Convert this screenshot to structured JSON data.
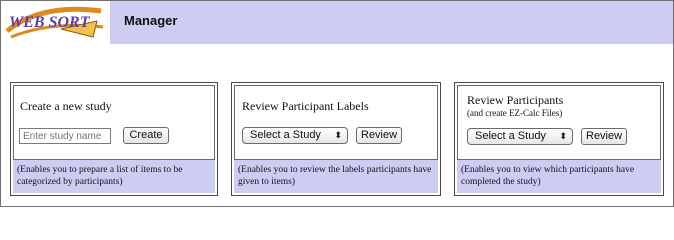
{
  "header": {
    "logo_text": "WEB SORT",
    "title": "Manager"
  },
  "panels": [
    {
      "title": "Create a new study",
      "input_placeholder": "Enter study name",
      "button_label": "Create",
      "description": "(Enables you to prepare a list of items to be categorized by participants)"
    },
    {
      "title": "Review Participant Labels",
      "select_label": "Select a Study",
      "select_arrow": "⬍",
      "button_label": "Review",
      "description": "(Enables you to review the labels participants have given to items)"
    },
    {
      "title": "Review Participants",
      "subtitle": "(and create EZ-Calc Files)",
      "select_label": "Select a Study",
      "select_arrow": "⬍",
      "button_label": "Review",
      "description": "(Enables you to view which participants have completed the study)"
    }
  ],
  "colors": {
    "header_bar": "#cdcdf3",
    "footer_band": "#cdcdf3",
    "logo_orange": "#e08a1e",
    "logo_purple": "#5b3fa0"
  }
}
